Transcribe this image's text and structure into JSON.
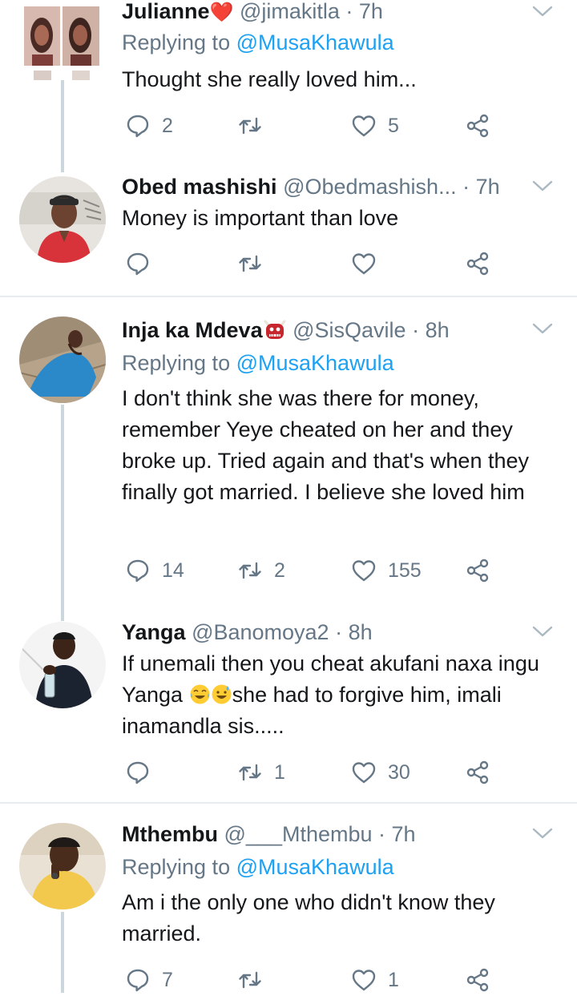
{
  "tweets": [
    {
      "name": "Julianne",
      "handle": "@jimakitla",
      "time": "· 7h",
      "replying_prefix": "Replying to ",
      "replying_to": "@MusaKhawula",
      "text": "Thought she really loved him...",
      "replies": "2",
      "retweets": "",
      "likes": "5"
    },
    {
      "name": "Obed mashishi",
      "handle": "@Obedmashish...",
      "time": "· 7h",
      "text": "Money is important than love",
      "replies": "",
      "retweets": "",
      "likes": ""
    },
    {
      "name": "Inja ka Mdeva",
      "handle": "@SisQavile",
      "time": "· 8h",
      "replying_prefix": "Replying to ",
      "replying_to": "@MusaKhawula",
      "text": "I don't think she was there for money, remember Yeye cheated on her and they broke up. Tried again and that's when they finally got married. I believe she loved him",
      "replies": "14",
      "retweets": "2",
      "likes": "155"
    },
    {
      "name": "Yanga",
      "handle": "@Banomoya2",
      "time": "· 8h",
      "text_part1": "If unemali then you cheat akufani naxa ingu Yanga ",
      "text_part2": "she had to forgive him, imali inamandla sis.....",
      "replies": "",
      "retweets": "1",
      "likes": "30"
    },
    {
      "name": "Mthembu",
      "handle": "@___Mthembu",
      "time": "· 7h",
      "replying_prefix": "Replying to ",
      "replying_to": "@MusaKhawula",
      "text": "Am i the only one who didn't know they married.",
      "replies": "7",
      "retweets": "",
      "likes": "1"
    }
  ],
  "colors": {
    "text": "#14171a",
    "secondary": "#657786",
    "link": "#1da1f2",
    "divider": "#e6ecf0",
    "thread_line": "#ccd6dd"
  },
  "icons": [
    "reply-icon",
    "retweet-icon",
    "like-icon",
    "share-icon",
    "chevron-down-icon"
  ]
}
